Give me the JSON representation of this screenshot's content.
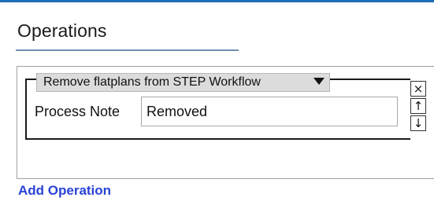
{
  "section": {
    "title": "Operations"
  },
  "operation": {
    "selected_operation": "Remove flatplans from STEP Workflow",
    "process_note_label": "Process Note",
    "process_note_value": "Removed"
  },
  "controls": {
    "close_icon": "×",
    "up_icon": "↑",
    "down_icon": "↓"
  },
  "actions": {
    "add_operation_label": "Add Operation"
  },
  "colors": {
    "top_bar": "#1e6fb8",
    "link": "#2a43d6"
  }
}
